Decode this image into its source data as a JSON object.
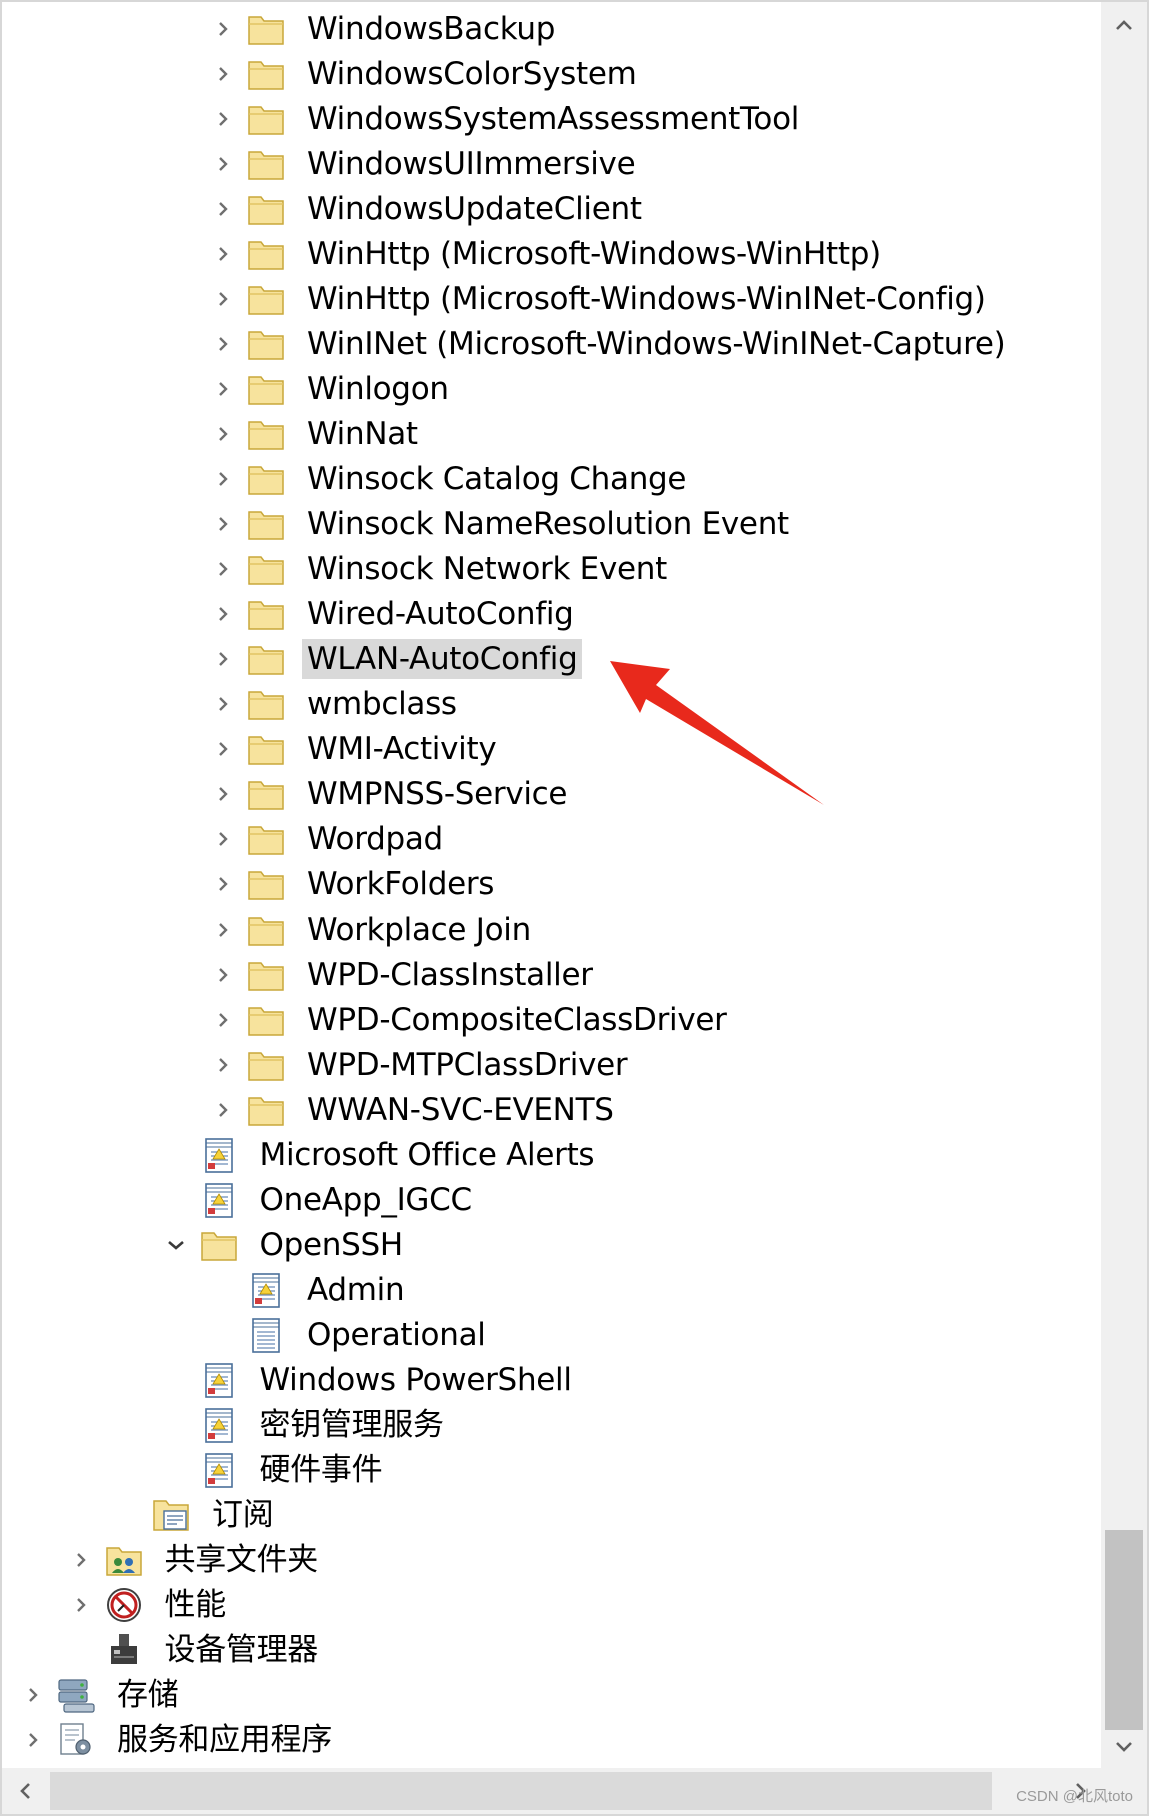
{
  "accent_color": "#e8291c",
  "tree": {
    "items": [
      {
        "label": "WindowsBackup",
        "icon": "folder-icon",
        "expander": "collapsed",
        "level": 4
      },
      {
        "label": "WindowsColorSystem",
        "icon": "folder-icon",
        "expander": "collapsed",
        "level": 4
      },
      {
        "label": "WindowsSystemAssessmentTool",
        "icon": "folder-icon",
        "expander": "collapsed",
        "level": 4
      },
      {
        "label": "WindowsUIImmersive",
        "icon": "folder-icon",
        "expander": "collapsed",
        "level": 4
      },
      {
        "label": "WindowsUpdateClient",
        "icon": "folder-icon",
        "expander": "collapsed",
        "level": 4
      },
      {
        "label": "WinHttp (Microsoft-Windows-WinHttp)",
        "icon": "folder-icon",
        "expander": "collapsed",
        "level": 4
      },
      {
        "label": "WinHttp (Microsoft-Windows-WinINet-Config)",
        "icon": "folder-icon",
        "expander": "collapsed",
        "level": 4
      },
      {
        "label": "WinINet (Microsoft-Windows-WinINet-Capture)",
        "icon": "folder-icon",
        "expander": "collapsed",
        "level": 4
      },
      {
        "label": "Winlogon",
        "icon": "folder-icon",
        "expander": "collapsed",
        "level": 4
      },
      {
        "label": "WinNat",
        "icon": "folder-icon",
        "expander": "collapsed",
        "level": 4
      },
      {
        "label": "Winsock Catalog Change",
        "icon": "folder-icon",
        "expander": "collapsed",
        "level": 4
      },
      {
        "label": "Winsock NameResolution Event",
        "icon": "folder-icon",
        "expander": "collapsed",
        "level": 4
      },
      {
        "label": "Winsock Network Event",
        "icon": "folder-icon",
        "expander": "collapsed",
        "level": 4
      },
      {
        "label": "Wired-AutoConfig",
        "icon": "folder-icon",
        "expander": "collapsed",
        "level": 4
      },
      {
        "label": "WLAN-AutoConfig",
        "icon": "folder-icon",
        "expander": "collapsed",
        "level": 4,
        "selected": true
      },
      {
        "label": "wmbclass",
        "icon": "folder-icon",
        "expander": "collapsed",
        "level": 4
      },
      {
        "label": "WMI-Activity",
        "icon": "folder-icon",
        "expander": "collapsed",
        "level": 4
      },
      {
        "label": "WMPNSS-Service",
        "icon": "folder-icon",
        "expander": "collapsed",
        "level": 4
      },
      {
        "label": "Wordpad",
        "icon": "folder-icon",
        "expander": "collapsed",
        "level": 4
      },
      {
        "label": "WorkFolders",
        "icon": "folder-icon",
        "expander": "collapsed",
        "level": 4
      },
      {
        "label": "Workplace Join",
        "icon": "folder-icon",
        "expander": "collapsed",
        "level": 4
      },
      {
        "label": "WPD-ClassInstaller",
        "icon": "folder-icon",
        "expander": "collapsed",
        "level": 4
      },
      {
        "label": "WPD-CompositeClassDriver",
        "icon": "folder-icon",
        "expander": "collapsed",
        "level": 4
      },
      {
        "label": "WPD-MTPClassDriver",
        "icon": "folder-icon",
        "expander": "collapsed",
        "level": 4
      },
      {
        "label": "WWAN-SVC-EVENTS",
        "icon": "folder-icon",
        "expander": "collapsed",
        "level": 4
      },
      {
        "label": "Microsoft Office Alerts",
        "icon": "event-log-icon",
        "expander": "none",
        "level": 3
      },
      {
        "label": "OneApp_IGCC",
        "icon": "event-log-icon",
        "expander": "none",
        "level": 3
      },
      {
        "label": "OpenSSH",
        "icon": "folder-icon",
        "expander": "expanded",
        "level": 3
      },
      {
        "label": "Admin",
        "icon": "event-log-icon",
        "expander": "none",
        "level": 4
      },
      {
        "label": "Operational",
        "icon": "log-icon",
        "expander": "none",
        "level": 4
      },
      {
        "label": "Windows PowerShell",
        "icon": "event-log-icon",
        "expander": "none",
        "level": 3
      },
      {
        "label": "密钥管理服务",
        "icon": "event-log-icon",
        "expander": "none",
        "level": 3
      },
      {
        "label": "硬件事件",
        "icon": "event-log-icon",
        "expander": "none",
        "level": 3
      },
      {
        "label": "订阅",
        "icon": "subscription-icon",
        "expander": "none",
        "level": 2
      },
      {
        "label": "共享文件夹",
        "icon": "shared-folder-icon",
        "expander": "collapsed",
        "level": 1
      },
      {
        "label": "性能",
        "icon": "performance-icon",
        "expander": "collapsed",
        "level": 1
      },
      {
        "label": "设备管理器",
        "icon": "device-manager-icon",
        "expander": "none",
        "level": 1
      },
      {
        "label": "存储",
        "icon": "storage-icon",
        "expander": "collapsed",
        "level": 0
      },
      {
        "label": "服务和应用程序",
        "icon": "services-icon",
        "expander": "collapsed",
        "level": 0
      }
    ]
  },
  "watermark": "CSDN @北风toto"
}
